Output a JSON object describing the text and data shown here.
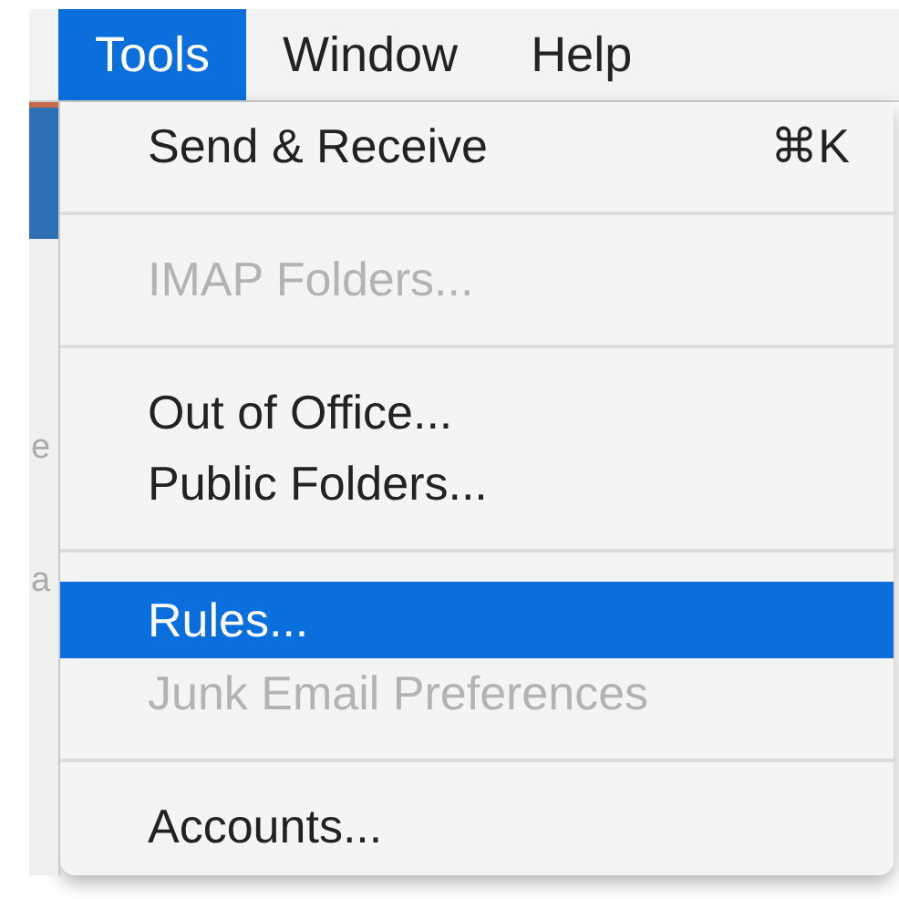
{
  "menu_bar": [
    {
      "label": "Tools",
      "selected": true
    },
    {
      "label": "Window",
      "selected": false
    },
    {
      "label": "Help",
      "selected": false
    }
  ],
  "background_window": {
    "fragments": [
      "e",
      "a"
    ]
  },
  "menu": [
    {
      "kind": "item",
      "label": "Send & Receive",
      "shortcut": "⌘K",
      "disabled": false,
      "selected": false
    },
    {
      "kind": "separator"
    },
    {
      "kind": "item",
      "label": "IMAP Folders...",
      "disabled": true,
      "selected": false
    },
    {
      "kind": "separator"
    },
    {
      "kind": "item",
      "label": "Out of Office...",
      "disabled": false,
      "selected": false
    },
    {
      "kind": "item",
      "label": "Public Folders...",
      "disabled": false,
      "selected": false
    },
    {
      "kind": "separator"
    },
    {
      "kind": "item",
      "label": "Rules...",
      "disabled": false,
      "selected": true
    },
    {
      "kind": "item",
      "label": "Junk Email Preferences",
      "disabled": true,
      "selected": false
    },
    {
      "kind": "separator"
    },
    {
      "kind": "item",
      "label": "Accounts...",
      "disabled": false,
      "selected": false
    }
  ]
}
